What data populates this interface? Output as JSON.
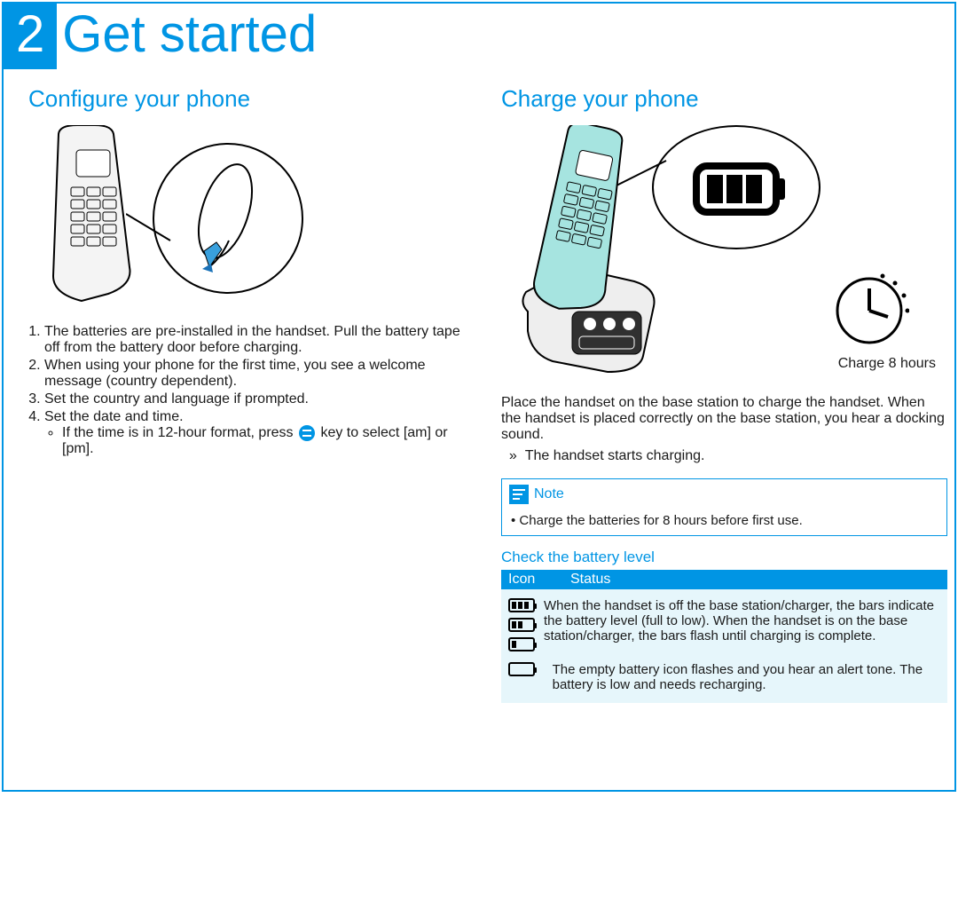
{
  "chapter": {
    "number": "2",
    "title": "Get started"
  },
  "left": {
    "heading": "Configure your phone",
    "steps": [
      "The batteries are pre-installed in the handset. Pull the battery tape off from the battery door before charging.",
      "When using your phone for the first time, you see a welcome message (country dependent).",
      "Set the country and language if prompted.",
      "Set the date and time."
    ],
    "substep_prefix": "If the time is in 12-hour format, press ",
    "substep_suffix": " key to select [am] or [pm].",
    "key_icon_name": "up-down-key-icon"
  },
  "right": {
    "heading": "Charge your phone",
    "charge_caption": "Charge 8 hours",
    "para1": "Place the handset on the base station to charge the handset. When the handset is placed correctly on the base station, you hear a docking sound.",
    "result": "The handset starts charging.",
    "note_label": "Note",
    "note_bullet": "Charge the batteries for 8 hours before first use.",
    "battery_heading": "Check the battery level",
    "table_headers": {
      "icon": "Icon",
      "status": "Status"
    },
    "row1_status": "When the handset is off the base station/charger, the bars indicate the battery level (full to low). When the handset is on the base station/charger, the bars flash until charging is complete.",
    "row2_status": "The empty battery icon flashes and you hear an alert tone. The battery is low and needs recharging."
  }
}
